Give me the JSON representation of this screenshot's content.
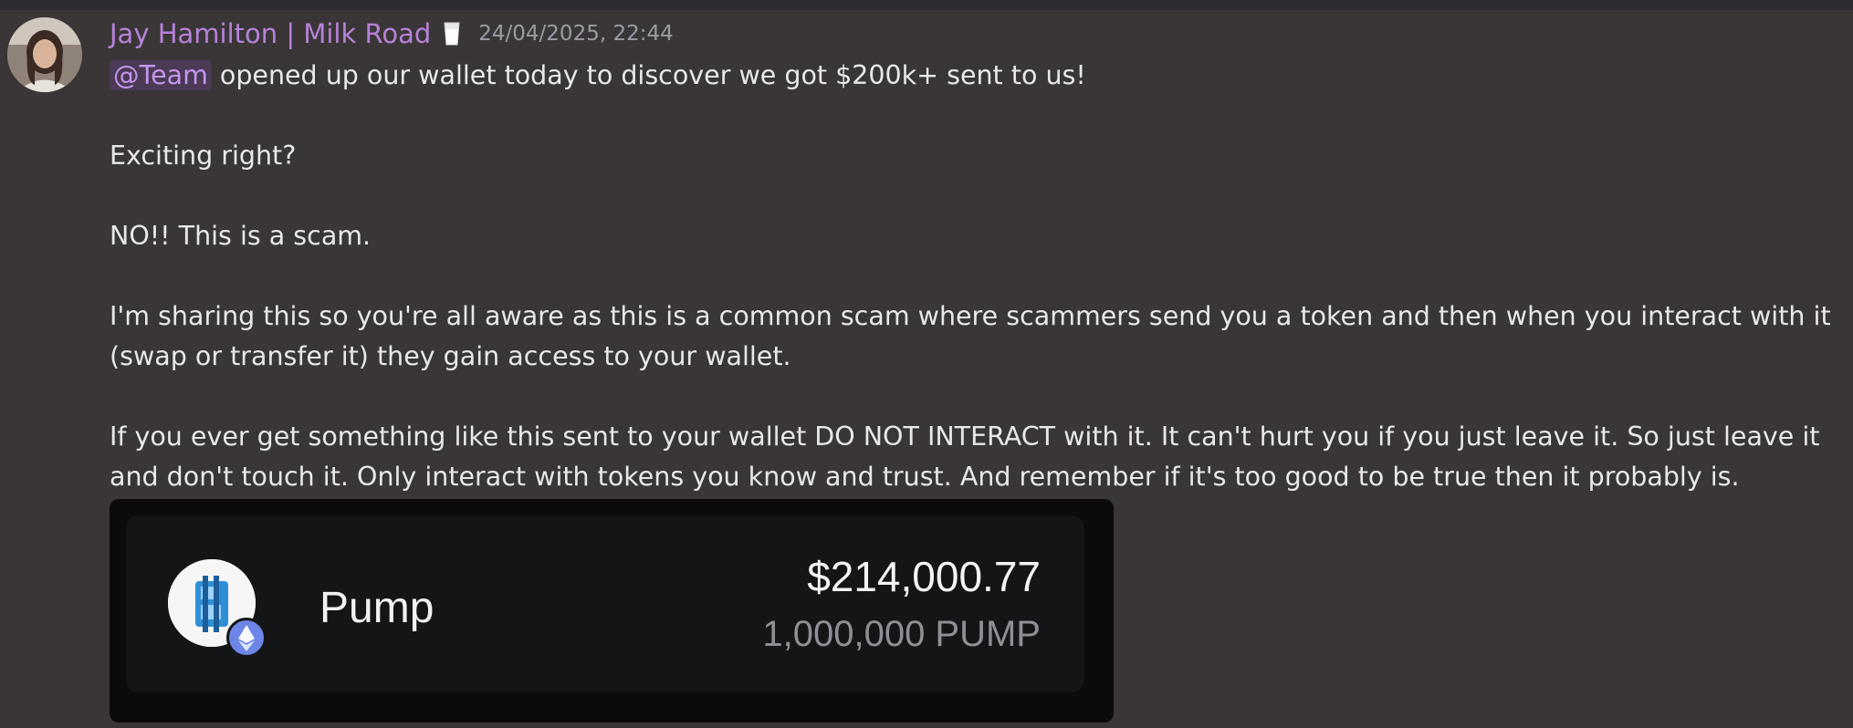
{
  "message": {
    "author": "Jay Hamilton | Milk Road",
    "timestamp": "24/04/2025, 22:44",
    "mention": "@Team",
    "line1_rest": " opened up our wallet today to discover we got $200k+ sent to us!",
    "line2": "Exciting right?",
    "line3": "NO!! This is a scam.",
    "line4": "I'm sharing this so you're all aware as this is a common scam where scammers send you a token and then when you interact with it (swap or transfer it) they gain access to your wallet.",
    "line5": "If you ever get something like this sent to your wallet DO NOT INTERACT with it. It can't hurt you if you just leave it. So just leave it and don't touch it. Only interact with tokens you know and trust. And remember if it's too good to be true then it probably is."
  },
  "embed": {
    "token_name": "Pump",
    "token_value": "$214,000.77",
    "token_amount": "1,000,000 PUMP"
  },
  "icons": {
    "avatar": "user-avatar",
    "role": "milk-glass-icon",
    "token_logo": "pump-token-icon",
    "chain": "ethereum-icon"
  },
  "colors": {
    "background": "#3a3637",
    "username": "#b782d9",
    "mention_bg": "#4a3a55",
    "mention_text": "#c596ec",
    "embed_bg": "#0b0b0d",
    "chain_badge": "#6d85e6"
  }
}
